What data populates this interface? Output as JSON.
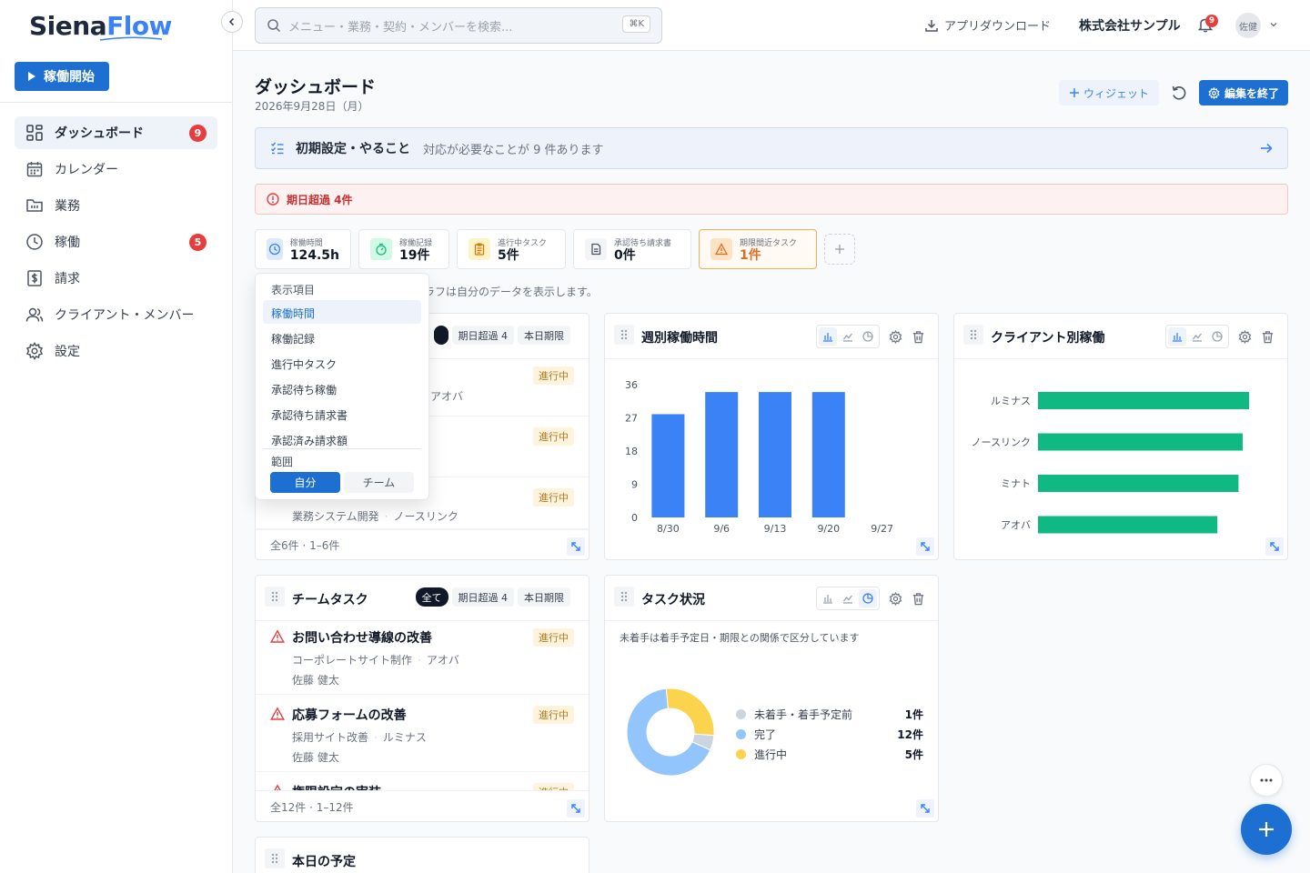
{
  "brand": {
    "part1": "Siena",
    "part2": "Flow"
  },
  "sidebar": {
    "start_label": "稼働開始",
    "items": [
      {
        "label": "ダッシュボード",
        "badge": "9"
      },
      {
        "label": "カレンダー"
      },
      {
        "label": "業務"
      },
      {
        "label": "稼働",
        "badge": "5"
      },
      {
        "label": "請求"
      },
      {
        "label": "クライアント・メンバー"
      },
      {
        "label": "設定"
      }
    ]
  },
  "header": {
    "search_placeholder": "メニュー・業務・契約・メンバーを検索...",
    "search_shortcut": "⌘K",
    "download_label": "アプリダウンロード",
    "company": "株式会社サンプル",
    "notif_count": "9",
    "avatar_initials": "佐健"
  },
  "page": {
    "title": "ダッシュボード",
    "date": "2026年9月28日（月）",
    "widget_label": "ウィジェット",
    "edit_done_label": "編集を終了"
  },
  "todo": {
    "title": "初期設定・やること",
    "message": "対応が必要なことが 9 件あります"
  },
  "alert": {
    "text": "期日超過 4件"
  },
  "stats": [
    {
      "label": "稼働時間",
      "value": "124.5h"
    },
    {
      "label": "稼働記録",
      "value": "19件"
    },
    {
      "label": "進行中タスク",
      "value": "5件"
    },
    {
      "label": "承認待ち請求書",
      "value": "0件"
    },
    {
      "label": "期限間近タスク",
      "value": "1件"
    }
  ],
  "note": "ラフは自分のデータを表示します。",
  "dropdown": {
    "header": "表示項目",
    "items": [
      "稼働時間",
      "稼働記録",
      "進行中タスク",
      "承認待ち稼働",
      "承認待ち請求書",
      "承認済み請求額"
    ],
    "selected_index": 0,
    "scope_label": "範囲",
    "scope_me": "自分",
    "scope_team": "チーム"
  },
  "my_tasks": {
    "chip_overdue": "期日超過 4",
    "chip_today": "本日期限",
    "rows": [
      {
        "status": "進行中",
        "sub": "アオバ"
      },
      {
        "status": "進行中"
      },
      {
        "status": "進行中",
        "project": "業務システム開発",
        "client": "ノースリンク"
      }
    ],
    "footer": "全6件 · 1–6件"
  },
  "weekly_chart": {
    "title": "週別稼働時間"
  },
  "client_chart": {
    "title": "クライアント別稼働"
  },
  "team_tasks": {
    "title": "チームタスク",
    "chip_all": "全て",
    "chip_overdue": "期日超過 4",
    "chip_today": "本日期限",
    "rows": [
      {
        "name": "お問い合わせ導線の改善",
        "project": "コーポレートサイト制作",
        "client": "アオバ",
        "user": "佐藤 健太",
        "status": "進行中"
      },
      {
        "name": "応募フォームの改善",
        "project": "採用サイト改善",
        "client": "ルミナス",
        "user": "佐藤 健太",
        "status": "進行中"
      },
      {
        "name": "権限設定の実装",
        "status": "進行中"
      }
    ],
    "footer": "全12件 · 1–12件"
  },
  "task_status": {
    "title": "タスク状況",
    "note": "未着手は着手予定日・期限との関係で区分しています"
  },
  "today_schedule": {
    "title": "本日の予定"
  },
  "chart_data": [
    {
      "type": "bar",
      "title": "週別稼働時間",
      "categories": [
        "8/30",
        "9/6",
        "9/13",
        "9/20",
        "9/27"
      ],
      "values": [
        28,
        34,
        34,
        34,
        0
      ],
      "yticks": [
        0,
        9,
        18,
        27,
        36
      ],
      "ylim": [
        0,
        36
      ],
      "color": "#3b82f6"
    },
    {
      "type": "bar",
      "orientation": "horizontal",
      "title": "クライアント別稼働",
      "categories": [
        "ルミナス",
        "ノースリンク",
        "ミナト",
        "アオバ"
      ],
      "values": [
        100,
        97,
        95,
        85
      ],
      "color": "#10b981"
    },
    {
      "type": "pie",
      "title": "タスク状況",
      "labels": [
        "未着手・着手予定前",
        "完了",
        "進行中"
      ],
      "values": [
        1,
        12,
        5
      ],
      "value_labels": [
        "1件",
        "12件",
        "5件"
      ],
      "colors": [
        "#cbd5e1",
        "#93c5fd",
        "#fcd34d"
      ]
    }
  ]
}
